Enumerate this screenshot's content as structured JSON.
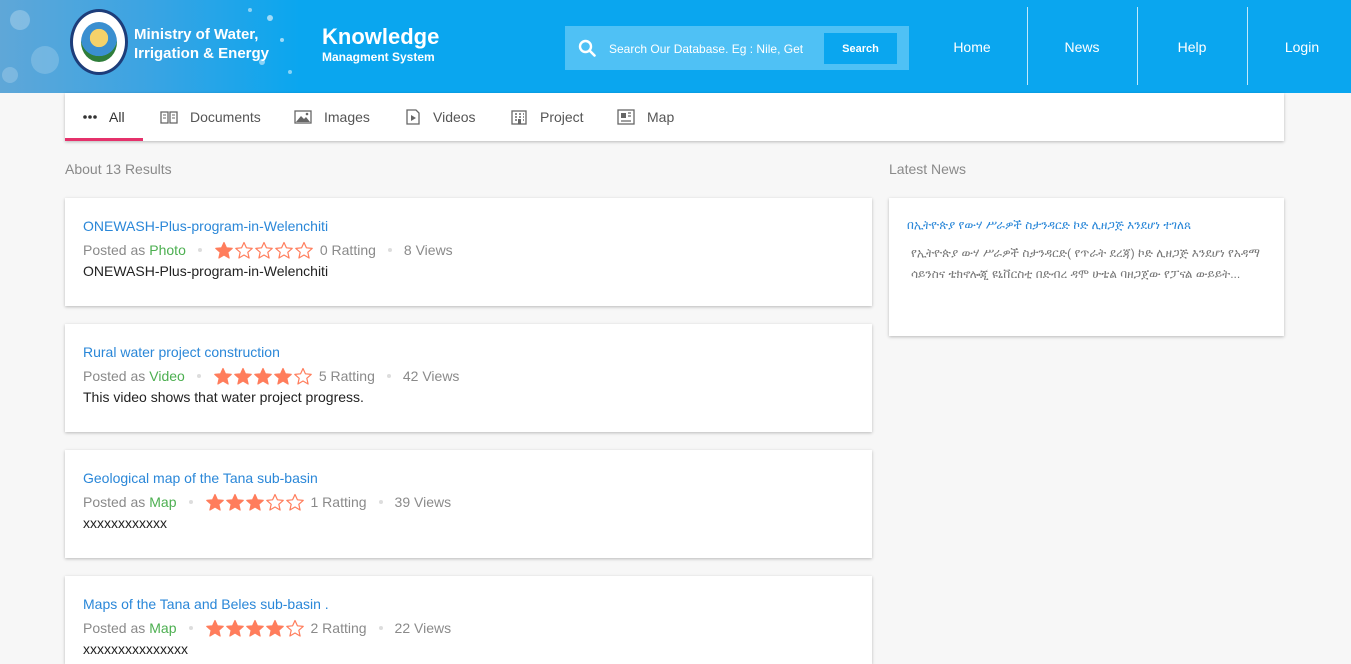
{
  "header": {
    "org_line1": "Ministry of Water,",
    "org_line2": "Irrigation & Energy",
    "kms_title": "Knowledge",
    "kms_subtitle": "Managment System",
    "search_placeholder": "Search Our Database. Eg : Nile, Get",
    "search_button": "Search",
    "nav": [
      "Home",
      "News",
      "Help",
      "Login"
    ]
  },
  "tabs": [
    {
      "label": "All",
      "icon": "more-dots-icon",
      "active": true
    },
    {
      "label": "Documents",
      "icon": "book-icon",
      "active": false
    },
    {
      "label": "Images",
      "icon": "image-icon",
      "active": false
    },
    {
      "label": "Videos",
      "icon": "video-icon",
      "active": false
    },
    {
      "label": "Project",
      "icon": "building-icon",
      "active": false
    },
    {
      "label": "Map",
      "icon": "map-icon",
      "active": false
    }
  ],
  "results": {
    "count_text": "About 13 Results",
    "items": [
      {
        "title": "ONEWASH-Plus-program-in-Welenchiti",
        "posted_prefix": "Posted as",
        "type": "Photo",
        "stars": 1,
        "rating_text": "0 Ratting",
        "views_text": "8 Views",
        "description": "ONEWASH-Plus-program-in-Welenchiti"
      },
      {
        "title": "Rural water project construction",
        "posted_prefix": "Posted as",
        "type": "Video",
        "stars": 4,
        "rating_text": "5 Ratting",
        "views_text": "42 Views",
        "description": "This video shows that water project progress."
      },
      {
        "title": "Geological map of the Tana sub-basin",
        "posted_prefix": "Posted as",
        "type": "Map",
        "stars": 3,
        "rating_text": "1 Ratting",
        "views_text": "39 Views",
        "description": "xxxxxxxxxxxx"
      },
      {
        "title": "Maps of the Tana and Beles sub-basin .",
        "posted_prefix": "Posted as",
        "type": "Map",
        "stars": 4,
        "rating_text": "2 Ratting",
        "views_text": "22 Views",
        "description": "xxxxxxxxxxxxxxx"
      }
    ]
  },
  "news": {
    "label": "Latest News",
    "title": "በኢትዮጵያ የውሃ ሥራዎች ስታንዳርድ ኮድ ሊዘጋጅ እንደሆነ ተገለጸ",
    "body": "የኢትዮጵያ ውሃ ሥራዎች ስታንዳርድ( የጥራት ደረጃ) ኮድ ሊዘጋጅ እንደሆነ የአዳማ ሳይንስና ቴክኖሎጂ ዩኒቨርስቲ በድብረ ዳሞ ሁቴል ባዘጋጀው የፓናል ውይይት..."
  },
  "colors": {
    "header_bg": "#0aa6ef",
    "accent_underline": "#e5316b",
    "link": "#2a87d8",
    "type_green": "#4caf50",
    "star": "#ff7d5c"
  }
}
